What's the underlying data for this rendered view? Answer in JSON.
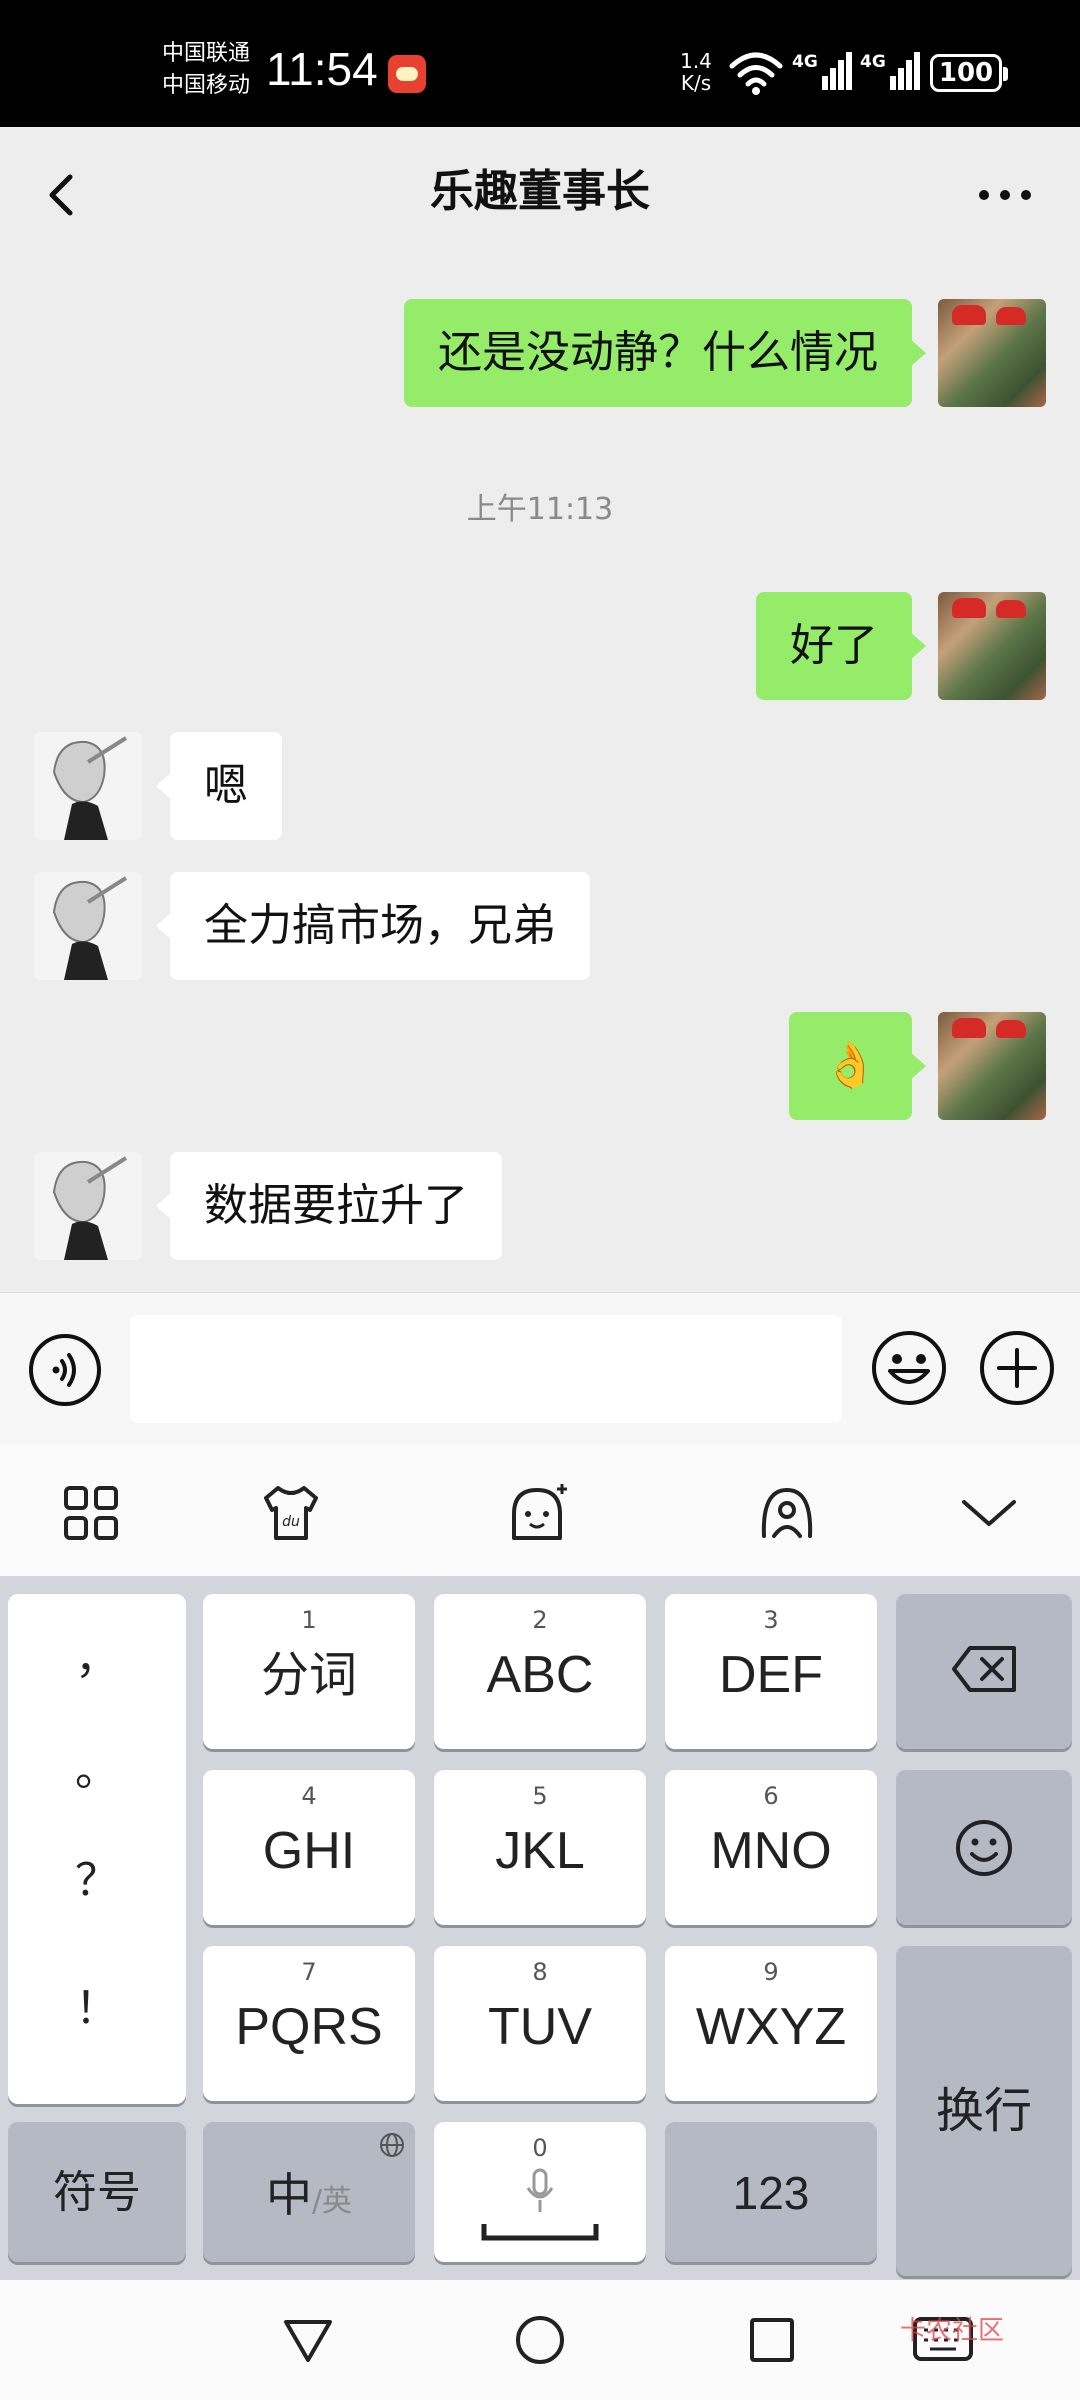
{
  "status_bar": {
    "carrier_1": "中国联通",
    "carrier_2": "中国移动",
    "time": "11:54",
    "net_speed_value": "1.4",
    "net_speed_unit": "K/s",
    "network_1": "4G",
    "network_2": "4G",
    "battery": "100"
  },
  "header": {
    "title": "乐趣董事长",
    "back_icon": "chevron-left-icon",
    "more_icon": "more-dots-icon"
  },
  "messages": [
    {
      "sender": "me",
      "text": "还是没动静？什么情况"
    },
    {
      "sender": "me",
      "text": "好了"
    },
    {
      "sender": "them",
      "text": "嗯"
    },
    {
      "sender": "them",
      "text": "全力搞市场，兄弟"
    },
    {
      "sender": "me",
      "text": "👌"
    },
    {
      "sender": "them",
      "text": "数据要拉升了"
    }
  ],
  "timestamp": "上午11:13",
  "input_bar": {
    "value": "",
    "voice_icon": "voice-icon",
    "emoji_icon": "emoji-icon",
    "plus_icon": "plus-icon"
  },
  "keyboard_toolbar": [
    "grid-icon",
    "shirt-du-icon",
    "sticker-icon",
    "skin-icon",
    "collapse-chevron-icon"
  ],
  "keyboard": {
    "punct": [
      "，",
      "。",
      "？",
      "！"
    ],
    "row1": [
      {
        "num": "1",
        "label": "分词"
      },
      {
        "num": "2",
        "label": "ABC"
      },
      {
        "num": "3",
        "label": "DEF"
      }
    ],
    "row2": [
      {
        "num": "4",
        "label": "GHI"
      },
      {
        "num": "5",
        "label": "JKL"
      },
      {
        "num": "6",
        "label": "MNO"
      }
    ],
    "row3": [
      {
        "num": "7",
        "label": "PQRS"
      },
      {
        "num": "8",
        "label": "TUV"
      },
      {
        "num": "9",
        "label": "WXYZ"
      }
    ],
    "symbol_key": "符号",
    "zh_key_main": "中",
    "zh_key_sub": "/英",
    "space_num": "0",
    "num_key": "123",
    "enter_key": "换行"
  },
  "watermark": "卡农社区"
}
